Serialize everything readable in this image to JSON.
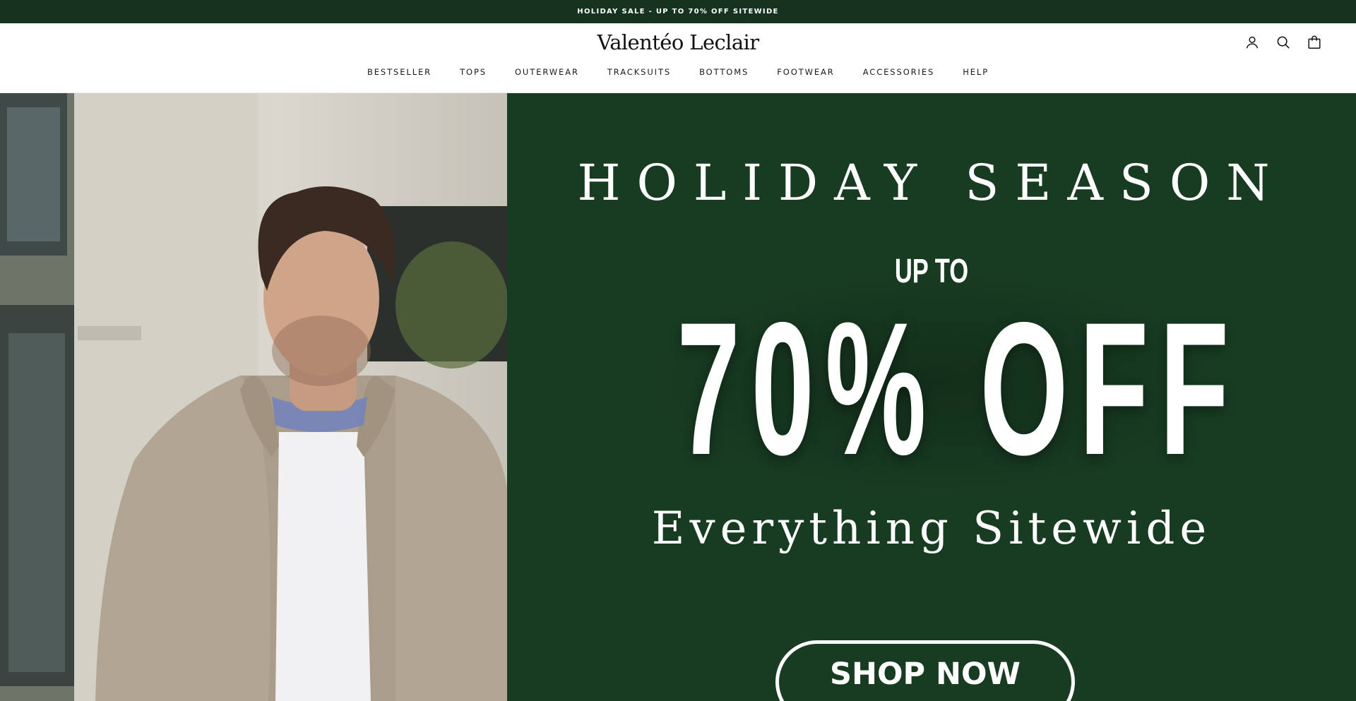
{
  "announcement": {
    "text": "HOLIDAY SALE - UP TO 70% OFF SITEWIDE"
  },
  "header": {
    "logo": "Valentéo Leclair",
    "icons": [
      "account-icon",
      "search-icon",
      "bag-icon"
    ]
  },
  "nav": {
    "items": [
      "BESTSELLER",
      "TOPS",
      "OUTERWEAR",
      "TRACKSUITS",
      "BOTTOMS",
      "FOOTWEAR",
      "ACCESSORIES",
      "HELP"
    ]
  },
  "hero": {
    "heading": "HOLIDAY SEASON",
    "upto": "UP TO",
    "discount": "70% OFF",
    "subheading": "Everything Sitewide",
    "cta": "SHOP NOW"
  },
  "colors": {
    "brand_green": "#183c22",
    "announce_bg": "#16331f",
    "text_white": "#ffffff"
  }
}
